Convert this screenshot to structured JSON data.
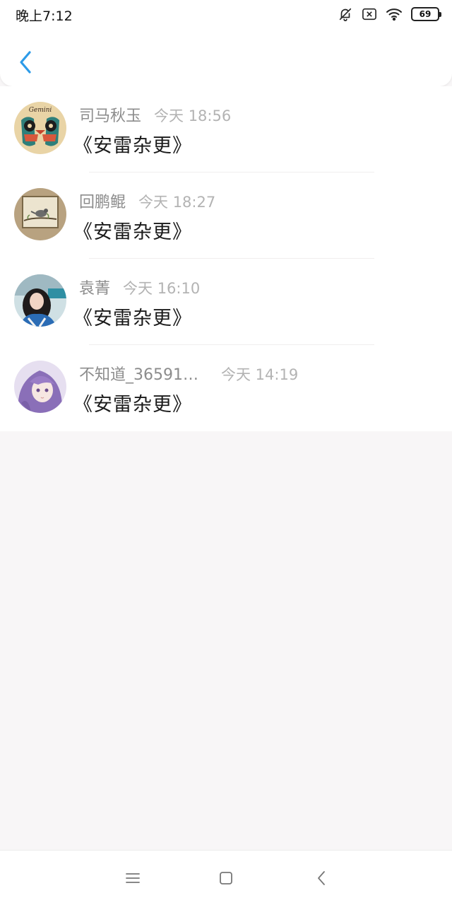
{
  "status": {
    "time": "晚上7:12",
    "battery": "69"
  },
  "header": {
    "back_icon": "chevron-left-icon",
    "accent": "#2d9be8"
  },
  "items": [
    {
      "username": "司马秋玉",
      "time": "今天 18:56",
      "message": "《安雷杂更》",
      "avatar": "gemini-owls"
    },
    {
      "username": "回鹏鲲",
      "time": "今天 18:27",
      "message": "《安雷杂更》",
      "avatar": "bird-on-branch"
    },
    {
      "username": "袁菁",
      "time": "今天 16:10",
      "message": "《安雷杂更》",
      "avatar": "girl-photo"
    },
    {
      "username": "不知道_36591…",
      "time": "今天 14:19",
      "message": "《安雷杂更》",
      "avatar": "anime-girl"
    }
  ],
  "navbar": {
    "menu_icon": "menu-icon",
    "home_icon": "home-square-icon",
    "back_icon": "back-triangle-icon"
  }
}
